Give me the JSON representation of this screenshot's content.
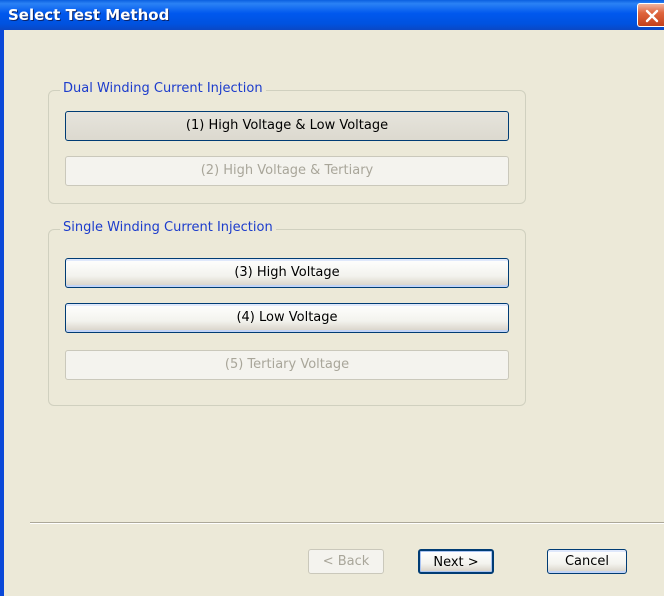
{
  "window": {
    "title": "Select Test Method"
  },
  "groups": {
    "dual": {
      "title": "Dual Winding Current Injection",
      "buttons": [
        {
          "label": "(1) High Voltage & Low Voltage",
          "enabled": true
        },
        {
          "label": "(2) High Voltage & Tertiary",
          "enabled": false
        }
      ]
    },
    "single": {
      "title": "Single Winding Current Injection",
      "buttons": [
        {
          "label": "(3) High Voltage",
          "enabled": true
        },
        {
          "label": "(4) Low Voltage",
          "enabled": true
        },
        {
          "label": "(5) Tertiary Voltage",
          "enabled": false
        }
      ]
    }
  },
  "footer": {
    "back_label": "< Back",
    "next_label": "Next >",
    "cancel_label": "Cancel"
  },
  "icons": {
    "close": "close-icon"
  },
  "colors": {
    "titlebar": "#0058ee",
    "dialog_bg": "#ece9d8",
    "group_title": "#1c3ccc",
    "disabled_text": "#a9a69a"
  }
}
